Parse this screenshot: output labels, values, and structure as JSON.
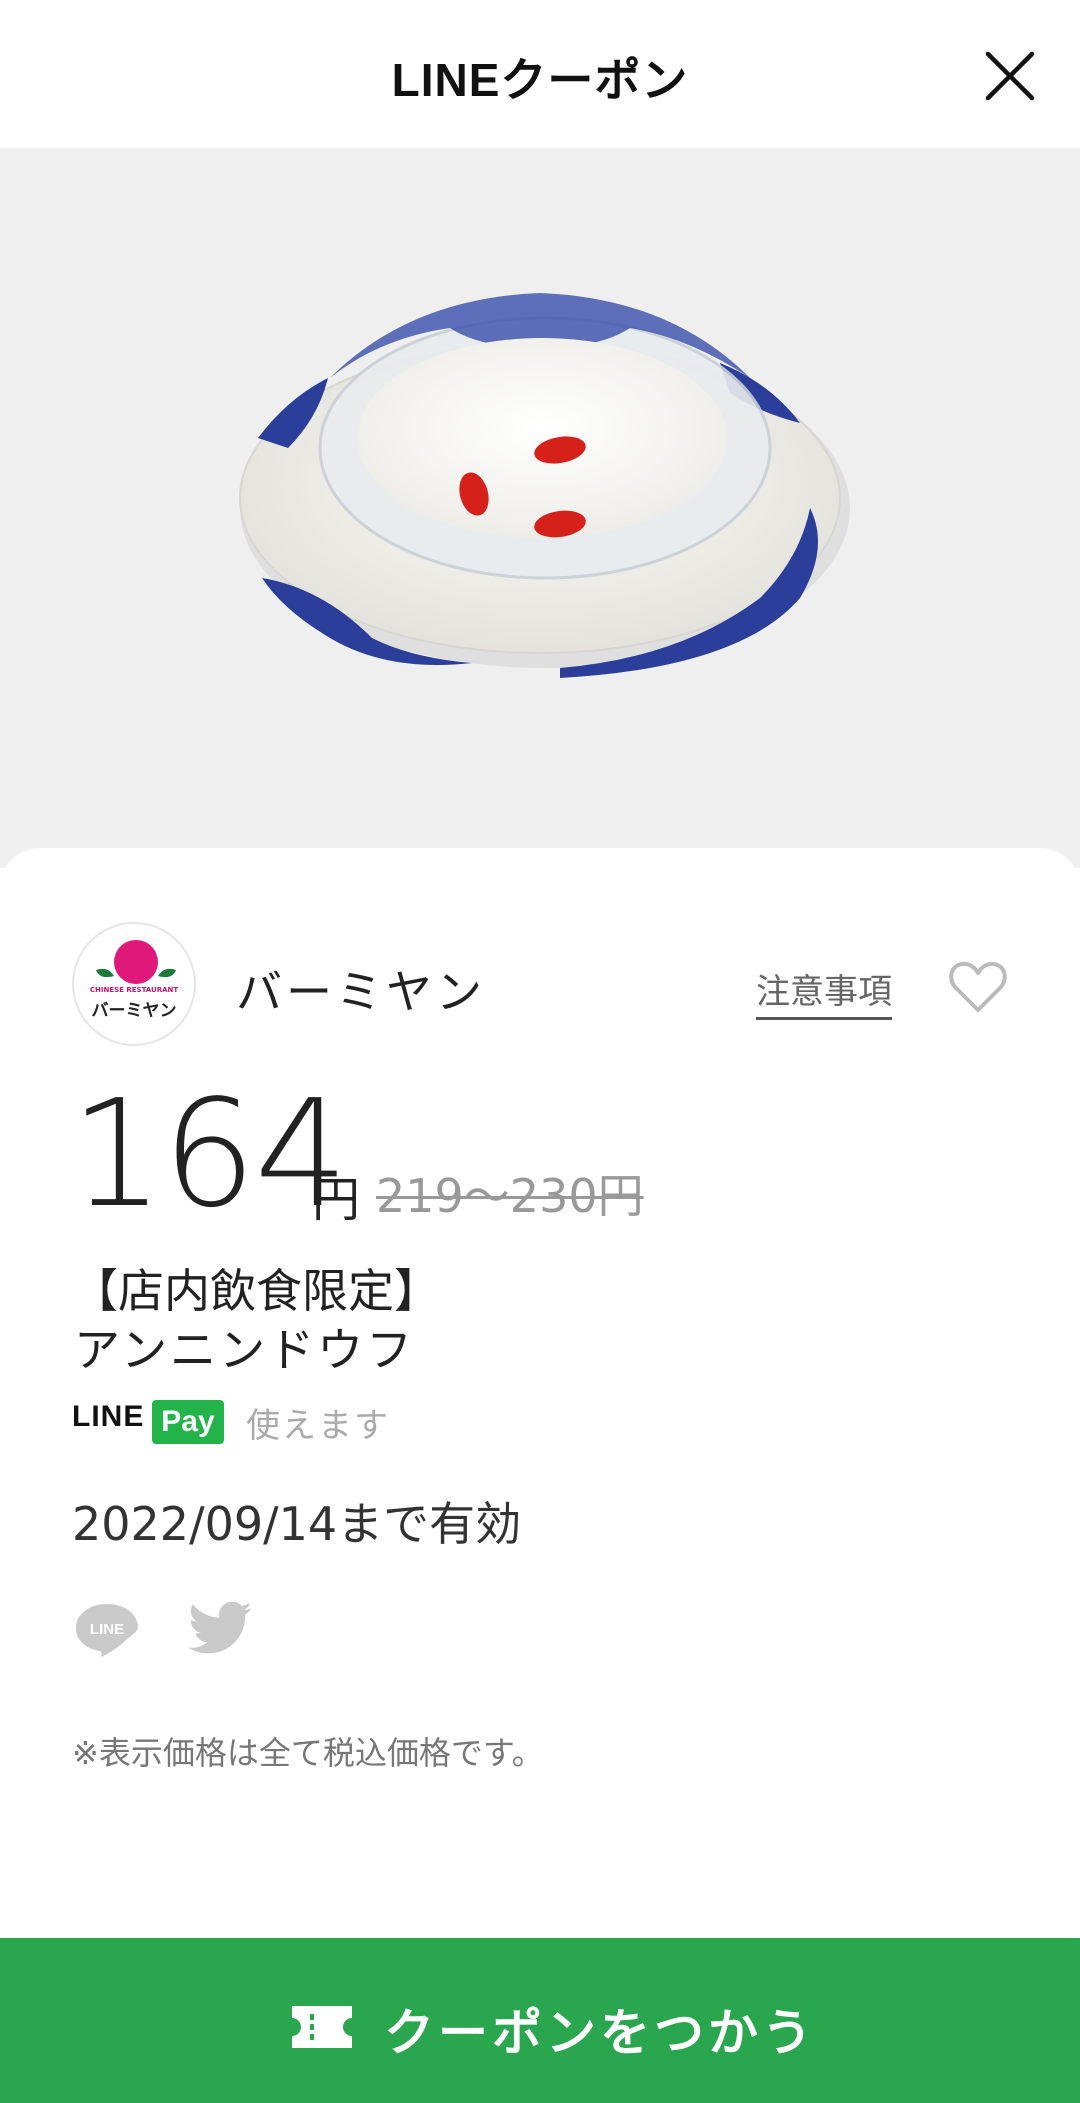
{
  "header": {
    "title": "LINEクーポン",
    "close_icon": "close-icon"
  },
  "store": {
    "name": "バーミヤン",
    "logo_text": "バーミヤン",
    "logo_subtext": "CHINESE RESTAURANT",
    "notes_label": "注意事項",
    "favorite_icon": "heart-outline-icon"
  },
  "coupon": {
    "price": "164",
    "currency": "円",
    "original_price": "219～230円",
    "title_line1": "【店内飲食限定】",
    "title_line2": "アンニンドウフ",
    "linepay_brand": "LINE",
    "linepay_badge": "Pay",
    "linepay_note": "使えます",
    "valid_until": "2022/09/14まで有効"
  },
  "share": {
    "line_icon": "line-share-icon",
    "twitter_icon": "twitter-share-icon"
  },
  "footer_note": "※表示価格は全て税込価格です。",
  "action": {
    "use_label": "クーポンをつかう",
    "ticket_icon": "ticket-icon"
  },
  "colors": {
    "brand_green": "#2aa64f",
    "linepay_green": "#22b44a",
    "photo_bg": "#efefef"
  }
}
